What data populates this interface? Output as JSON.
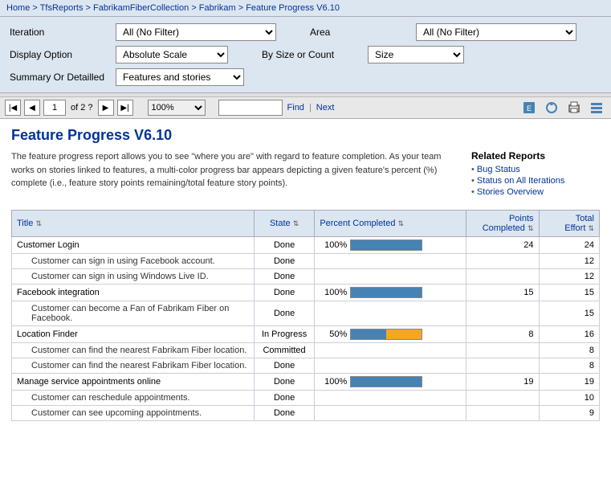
{
  "breadcrumb": {
    "items": [
      "Home",
      "TfsReports",
      "FabrikamFiberCollection",
      "Fabrikam",
      "Feature Progress V6.10"
    ],
    "separator": " > "
  },
  "filters": {
    "iteration_label": "Iteration",
    "iteration_value": "All (No Filter)",
    "area_label": "Area",
    "area_value": "All (No Filter)",
    "display_option_label": "Display Option",
    "display_option_value": "Absolute Scale",
    "by_size_label": "By Size or Count",
    "by_size_value": "Size",
    "summary_label": "Summary Or Detailled",
    "summary_value": "Features and stories"
  },
  "toolbar": {
    "page_current": "1",
    "page_total": "of 2 ?",
    "zoom_value": "100%",
    "find_placeholder": "",
    "find_label": "Find",
    "next_label": "Next"
  },
  "report": {
    "title": "Feature Progress V6.10",
    "description": "The feature progress report allows you to see \"where you are\" with regard to feature completion. As your team works on stories linked to features, a multi-color progress bar appears depicting a given feature's percent (%) complete (i.e., feature story points remaining/total feature story points).",
    "related_reports_title": "Related Reports",
    "related_links": [
      {
        "label": "Bug Status",
        "href": "#"
      },
      {
        "label": "Status on All Iterations",
        "href": "#"
      },
      {
        "label": "Stories Overview",
        "href": "#"
      }
    ]
  },
  "table": {
    "columns": [
      {
        "key": "title",
        "label": "Title",
        "sort": true
      },
      {
        "key": "state",
        "label": "State",
        "sort": true
      },
      {
        "key": "percent",
        "label": "Percent Completed",
        "sort": true
      },
      {
        "key": "points",
        "label": "Points Completed",
        "sort": true
      },
      {
        "key": "effort",
        "label": "Total Effort",
        "sort": true
      }
    ],
    "rows": [
      {
        "type": "feature",
        "title": "Customer Login",
        "state": "Done",
        "percent": 100,
        "points": 24,
        "effort": 24
      },
      {
        "type": "story",
        "title": "Customer can sign in using Facebook account.",
        "state": "Done",
        "percent": null,
        "points": null,
        "effort": 12
      },
      {
        "type": "story",
        "title": "Customer can sign in using Windows Live ID.",
        "state": "Done",
        "percent": null,
        "points": null,
        "effort": 12
      },
      {
        "type": "feature",
        "title": "Facebook integration",
        "state": "Done",
        "percent": 100,
        "points": 15,
        "effort": 15
      },
      {
        "type": "story",
        "title": "Customer can become a Fan of Fabrikam Fiber on Facebook.",
        "state": "Done",
        "percent": null,
        "points": null,
        "effort": 15
      },
      {
        "type": "feature",
        "title": "Location Finder",
        "state": "In Progress",
        "percent": 50,
        "points": 8,
        "effort": 16
      },
      {
        "type": "story",
        "title": "Customer can find the nearest Fabrikam Fiber location.",
        "state": "Committed",
        "percent": null,
        "points": null,
        "effort": 8
      },
      {
        "type": "story",
        "title": "Customer can find the nearest Fabrikam Fiber location.",
        "state": "Done",
        "percent": null,
        "points": null,
        "effort": 8
      },
      {
        "type": "feature",
        "title": "Manage service appointments online",
        "state": "Done",
        "percent": 100,
        "points": 19,
        "effort": 19
      },
      {
        "type": "story",
        "title": "Customer can reschedule appointments.",
        "state": "Done",
        "percent": null,
        "points": null,
        "effort": 10
      },
      {
        "type": "story",
        "title": "Customer can see upcoming appointments.",
        "state": "Done",
        "percent": null,
        "points": null,
        "effort": 9
      }
    ]
  },
  "colors": {
    "progress_complete": "#4682b4",
    "progress_remaining": "#f5a623",
    "header_bg": "#dce6f0",
    "link_color": "#003399"
  }
}
